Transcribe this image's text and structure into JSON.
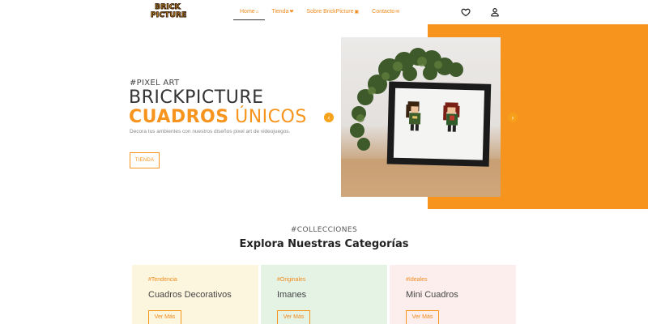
{
  "nav": {
    "logo_line1": "BRICK",
    "logo_line2": "PICTURE",
    "items": [
      {
        "label": "Home",
        "icon": "home-icon",
        "active": true
      },
      {
        "label": "Tienda",
        "icon": "heart-icon",
        "active": false
      },
      {
        "label": "Sobre BrickPicture",
        "icon": "lock-icon",
        "active": false
      },
      {
        "label": "Contacto",
        "icon": "mail-icon",
        "active": false
      }
    ],
    "wishlist_icon": "heart-outline-icon",
    "account_icon": "user-icon"
  },
  "hero": {
    "tagline": "#PIXEL ART",
    "title": "BRICKPICTURE",
    "subtitle_bold": "CUADROS",
    "subtitle_rest": " ÚNICOS",
    "description": "Decora tus ambientes con nuestros diseños pixel art de videojuegos.",
    "button": "TIENDA",
    "accent_color": "#f7941d",
    "prev_icon": "chevron-left-icon",
    "next_icon": "chevron-right-icon"
  },
  "collections": {
    "tag": "#COLLECCIONES",
    "title": "Explora Nuestras Categorías",
    "cards": [
      {
        "tag": "#Tendencia",
        "name": "Cuadros Decorativos",
        "button": "Ver Más",
        "bg": "#fdf6de"
      },
      {
        "tag": "#Originales",
        "name": "Imanes",
        "button": "Ver Más",
        "bg": "#e5f3e5"
      },
      {
        "tag": "#Ideales",
        "name": "Mini Cuadros",
        "button": "Ver Más",
        "bg": "#fdeeee"
      }
    ]
  }
}
